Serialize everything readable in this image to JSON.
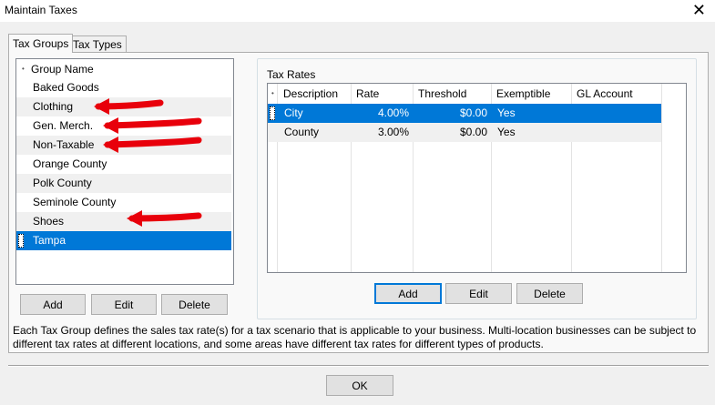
{
  "window": {
    "title": "Maintain Taxes",
    "close_icon": "✕"
  },
  "tabs": [
    {
      "label": "Tax Groups",
      "active": true
    },
    {
      "label": "Tax Types",
      "active": false
    }
  ],
  "groups": {
    "header": "Group Name",
    "items": [
      "Baked Goods",
      "Clothing",
      "Gen. Merch.",
      "Non-Taxable",
      "Orange County",
      "Polk County",
      "Seminole County",
      "Shoes",
      "Tampa"
    ],
    "selected": "Tampa",
    "buttons": {
      "add": "Add",
      "edit": "Edit",
      "delete": "Delete"
    }
  },
  "tax_rates": {
    "title": "Tax Rates",
    "columns": [
      "Description",
      "Rate",
      "Threshold",
      "Exemptible",
      "GL Account"
    ],
    "rows": [
      {
        "description": "City",
        "rate": "4.00%",
        "threshold": "$0.00",
        "exemptible": "Yes",
        "gl_account": ""
      },
      {
        "description": "County",
        "rate": "3.00%",
        "threshold": "$0.00",
        "exemptible": "Yes",
        "gl_account": ""
      }
    ],
    "selected_row": 0,
    "buttons": {
      "add": "Add",
      "edit": "Edit",
      "delete": "Delete"
    }
  },
  "description": "Each Tax Group defines the sales tax rate(s) for a tax scenario that is applicable to your business. Multi-location businesses can be subject to different tax rates at different locations, and some areas have different tax rates for different types of products.",
  "footer": {
    "ok": "OK"
  },
  "annotations": {
    "arrow_color": "#e8000b",
    "arrow_icon": "red-arrow-icon"
  },
  "colors": {
    "selection": "#0078d7",
    "window_bg": "#f0f0f0",
    "tab_bg": "#f9f9f9"
  }
}
